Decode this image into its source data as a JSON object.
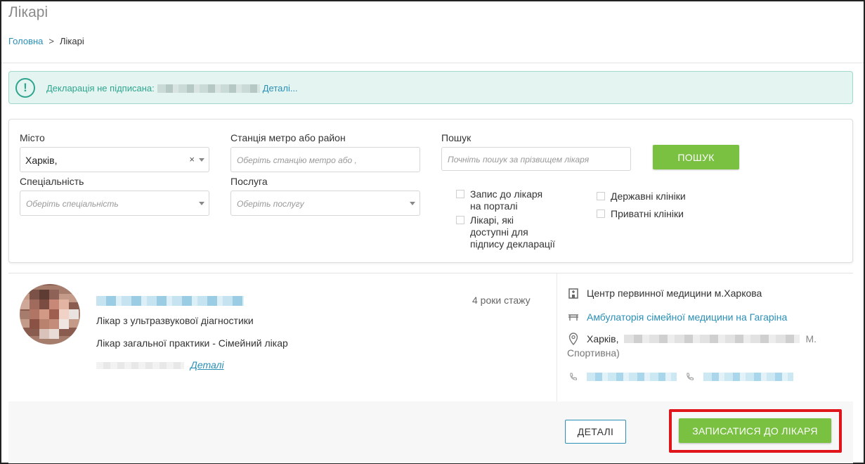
{
  "page": {
    "title": "Лікарі"
  },
  "breadcrumb": {
    "home": "Головна",
    "separator": ">",
    "current": "Лікарі"
  },
  "alert": {
    "message": "Декларація не підписана:",
    "link": "Деталі...",
    "icon": "exclamation-circle-icon"
  },
  "filters": {
    "city": {
      "label": "Місто",
      "value": "Харків,"
    },
    "metro": {
      "label": "Станція метро або район",
      "placeholder": "Оберіть станцію метро або ,"
    },
    "search": {
      "label": "Пошук",
      "placeholder": "Почніть пошук за прізвищем лікаря"
    },
    "search_button": "ПОШУК",
    "specialty": {
      "label": "Спеціальність",
      "placeholder": "Оберіть спеціальність"
    },
    "service": {
      "label": "Послуга",
      "placeholder": "Оберіть послугу"
    },
    "checkboxes": {
      "portal_booking": [
        "Запис до лікаря",
        "на порталі"
      ],
      "declaration_available": [
        "Лікарі, які",
        "доступні для",
        "підпису декларації"
      ],
      "state_clinics": "Державні клініки",
      "private_clinics": "Приватні клініки"
    }
  },
  "doctor": {
    "experience": "4 роки стажу",
    "specialties": [
      "Лікар з ультразвукової діагностики",
      "Лікар загальної практики - Сімейний лікар"
    ],
    "details_link": "Деталі",
    "clinic": "Центр первинної медицини м.Харкова",
    "ambulatory": "Амбулаторія сімейної медицини на Гагаріна",
    "address_city": "Харків,",
    "address_suffix": "М.",
    "address_line2": "Спортивна)",
    "details_button": "ДЕТАЛІ",
    "book_button": "ЗАПИСАТИСЯ ДО ЛІКАРЯ"
  },
  "colors": {
    "accent_green": "#7ac142",
    "link_blue": "#2a8fb6",
    "alert_teal": "#2ea58e",
    "highlight_red": "#e0141b"
  }
}
